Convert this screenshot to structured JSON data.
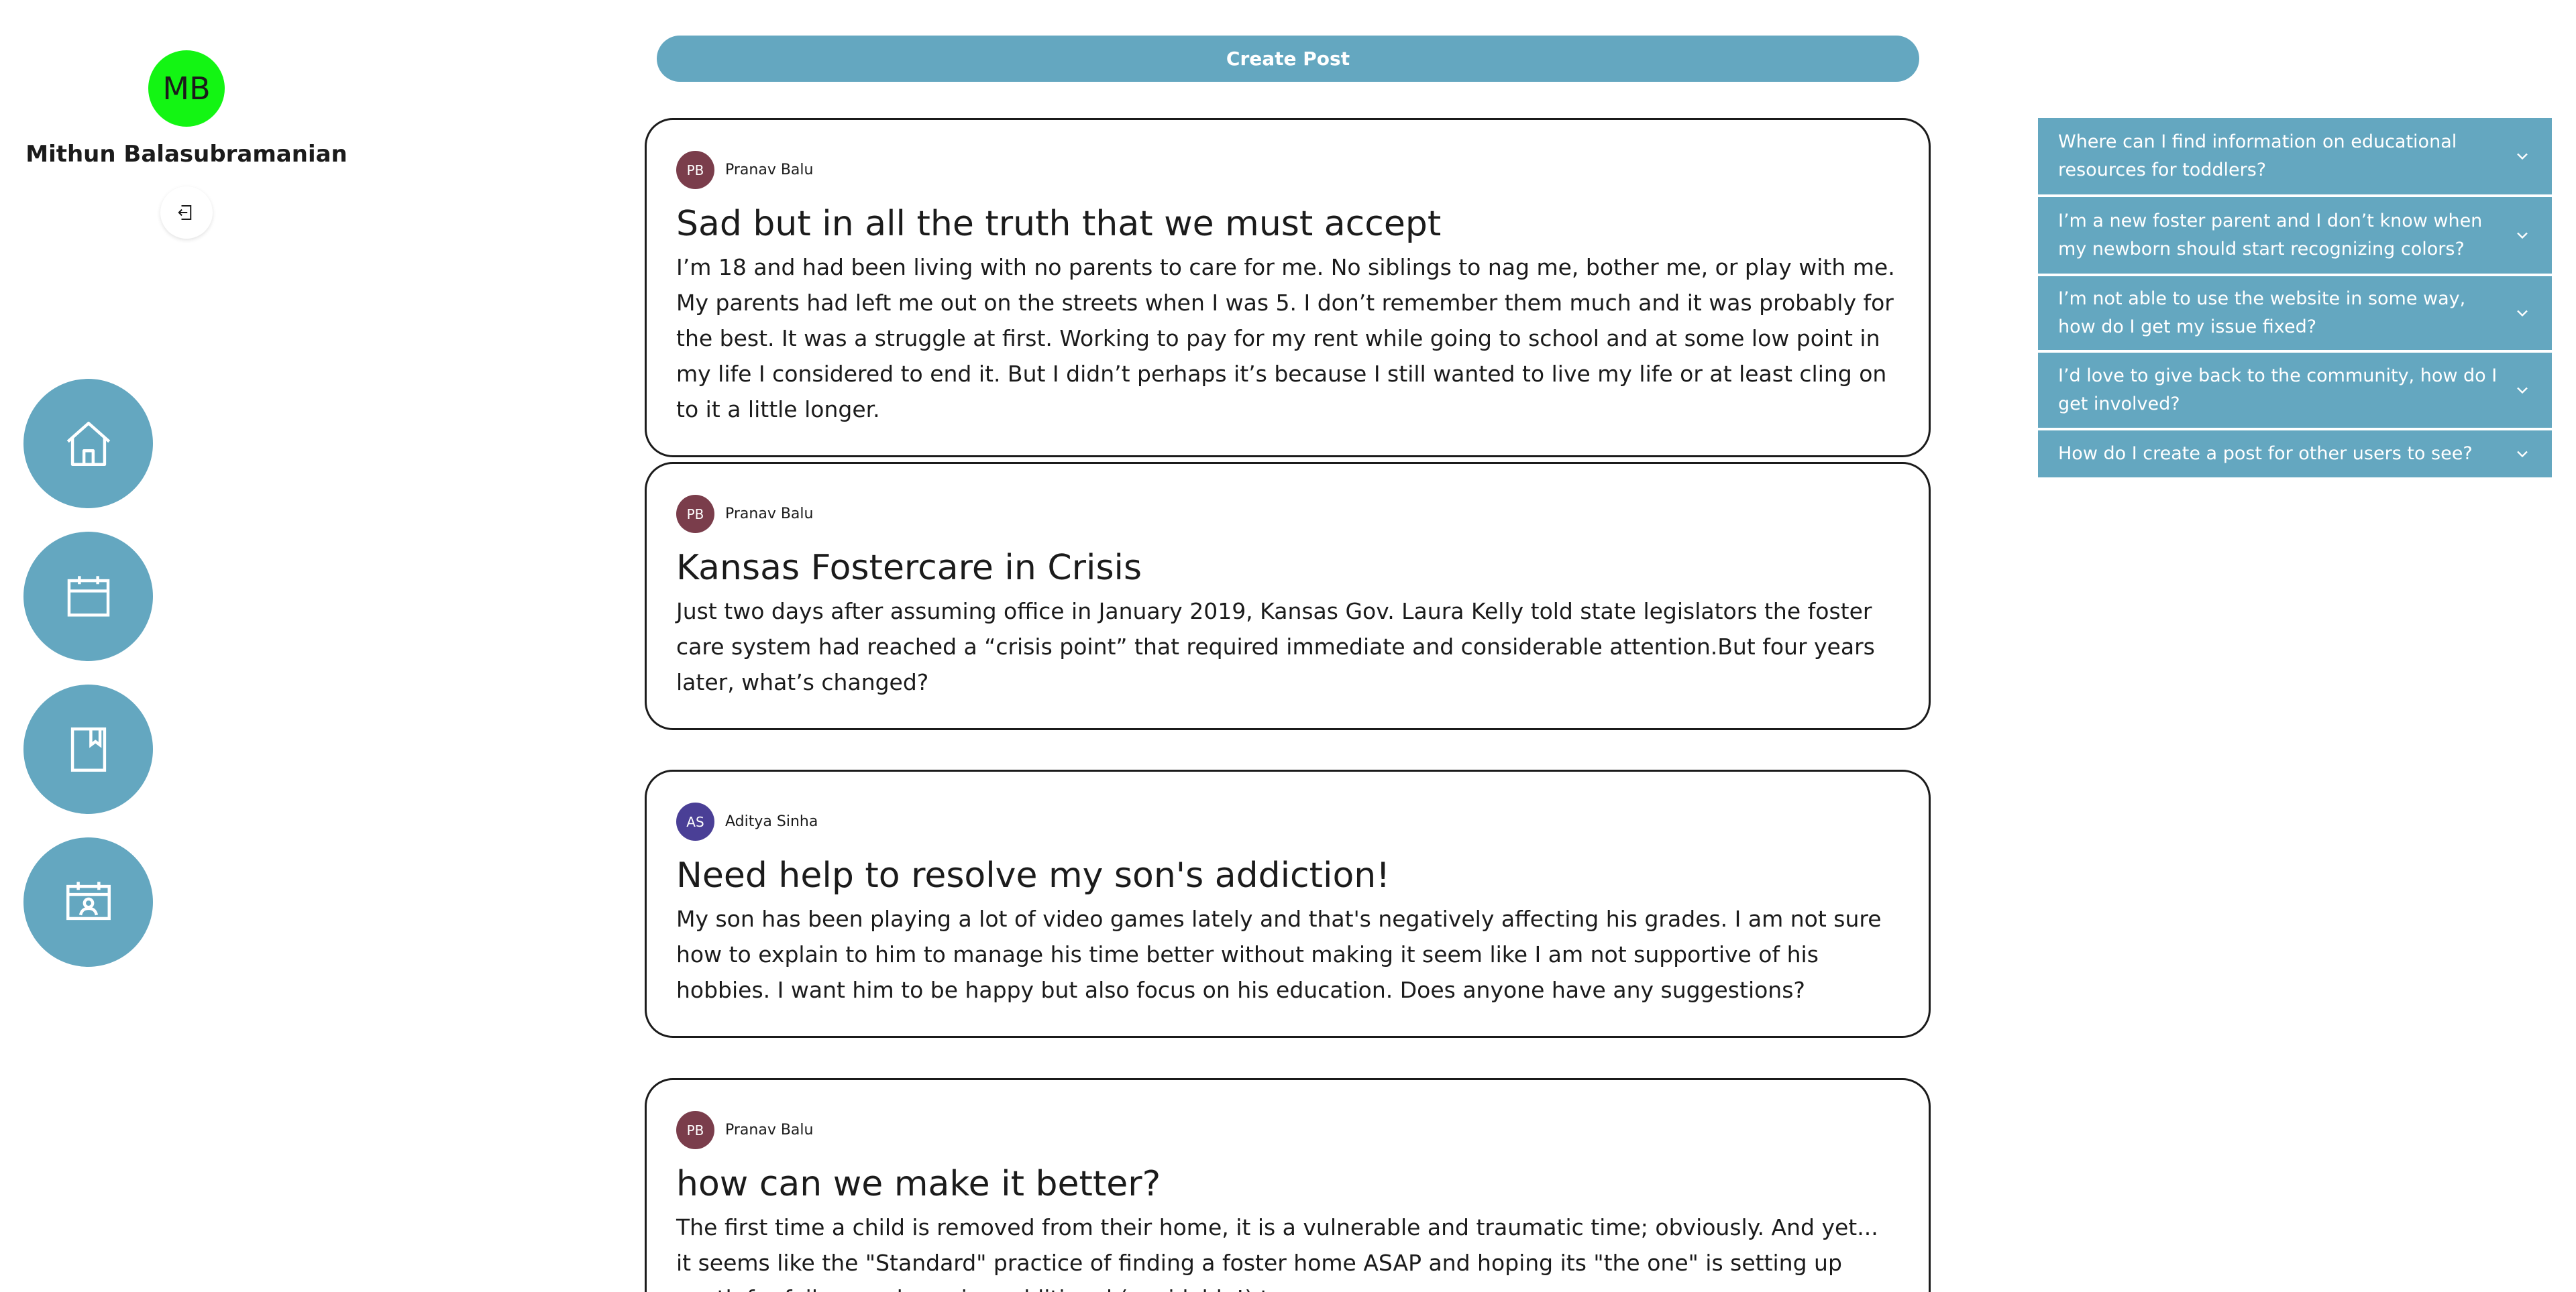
{
  "user": {
    "initials": "MB",
    "name": "Mithun Balasubramanian"
  },
  "nav": {
    "items": [
      {
        "icon": "home-icon"
      },
      {
        "icon": "calendar-icon"
      },
      {
        "icon": "bookmark-book-icon"
      },
      {
        "icon": "calendar-person-icon"
      }
    ]
  },
  "feed": {
    "create_label": "Create Post",
    "posts": [
      {
        "author_initials": "PB",
        "author": "Pranav Balu",
        "title": "Sad but in all the truth that we must accept",
        "body": "I’m 18 and had been living with no parents to care for me. No siblings to nag me, bother me, or play with me. My parents had left me out on the streets when I was 5. I don’t remember them much and it was probably for the best. It was a struggle at first. Working to pay for my rent while going to school and at some low point in my life I considered to end it. But I didn’t perhaps it’s because I still wanted to live my life or at least cling on to it a little longer."
      },
      {
        "author_initials": "PB",
        "author": "Pranav Balu",
        "title": "Kansas Fostercare in Crisis",
        "body": "Just two days after assuming office in January 2019, Kansas Gov. Laura Kelly told state legislators the foster care system had reached a “crisis point” that required immediate and considerable attention.But four years later, what’s changed?"
      },
      {
        "author_initials": "AS",
        "author": "Aditya Sinha",
        "title": "Need help to resolve my son's addiction!",
        "body": "My son has been playing a lot of video games lately and that's negatively affecting his grades. I am not sure how to explain to him to manage his time better without making it seem like I am not supportive of his hobbies. I want him to be happy but also focus on his education. Does anyone have any suggestions?"
      },
      {
        "author_initials": "PB",
        "author": "Pranav Balu",
        "title": "how can we make it better?",
        "body": "The first time a child is removed from their home, it is a vulnerable and traumatic time; obviously. And yet... it seems like the \"Standard\" practice of finding a foster home ASAP and hoping its \"the one\" is setting up youth for failure and causing additional (avoidable!) trauma."
      }
    ]
  },
  "faq": {
    "items": [
      {
        "question": "Where can I find information on educational resources for toddlers?"
      },
      {
        "question": "I’m a new foster parent and I don’t know when my newborn should start recognizing colors?"
      },
      {
        "question": "I’m not able to use the website in some way, how do I get my issue fixed?"
      },
      {
        "question": "I’d love to give back to the community, how do I get involved?"
      },
      {
        "question": "How do I create a post for other users to see?"
      }
    ]
  },
  "colors": {
    "accent": "#64a7c0",
    "user_avatar": "#13f513",
    "avatar_pb": "#7a3d4b",
    "avatar_as": "#4a3f96"
  }
}
